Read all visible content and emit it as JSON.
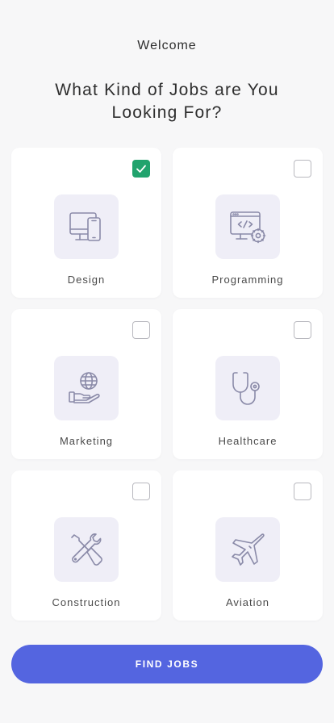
{
  "header": {
    "welcome": "Welcome",
    "title": "What Kind of Jobs are You Looking For?"
  },
  "categories": [
    {
      "label": "Design",
      "icon": "devices-icon",
      "checked": true
    },
    {
      "label": "Programming",
      "icon": "code-settings-icon",
      "checked": false
    },
    {
      "label": "Marketing",
      "icon": "globe-hand-icon",
      "checked": false
    },
    {
      "label": "Healthcare",
      "icon": "stethoscope-icon",
      "checked": false
    },
    {
      "label": "Construction",
      "icon": "tools-icon",
      "checked": false
    },
    {
      "label": "Aviation",
      "icon": "airplane-icon",
      "checked": false
    }
  ],
  "cta": {
    "label": "FIND JOBS"
  },
  "colors": {
    "background": "#f7f7f8",
    "card": "#ffffff",
    "icon_bg": "#efeef7",
    "icon_stroke": "#8a8aa8",
    "checked": "#21a36d",
    "cta": "#5465e0"
  }
}
